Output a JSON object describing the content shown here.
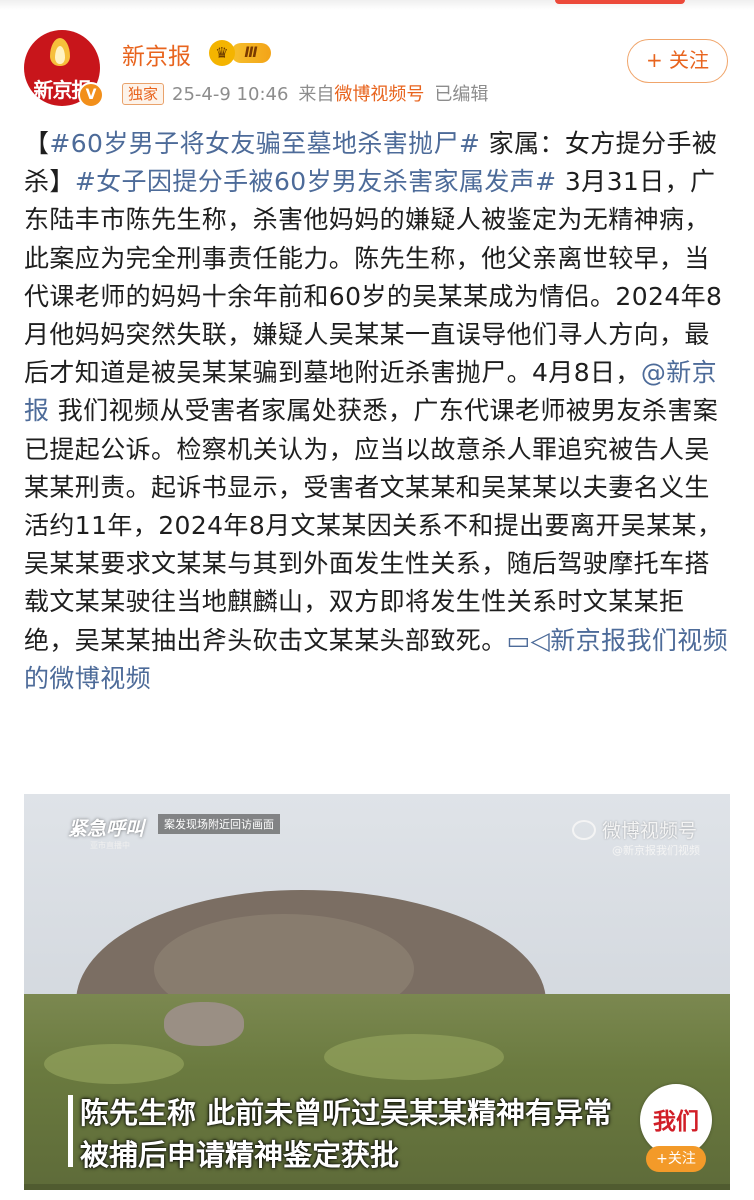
{
  "post": {
    "author": "新京报",
    "vip_level": "Ⅲ",
    "avatar_text": "新京报",
    "tag": "独家",
    "time": "25-4-9 10:46",
    "source_prefix": "来自",
    "source": "微博视频号",
    "edited": "已编辑",
    "follow_label": "+ 关注",
    "text": {
      "open_bracket": "【",
      "topic1": "#60岁男子将女友骗至墓地杀害抛尸#",
      "t1": " 家属：女方提分手被杀】",
      "topic2": "#女子因提分手被60岁男友杀害家属发声#",
      "t2": " 3月31日，广东陆丰市陈先生称，杀害他妈妈的嫌疑人被鉴定为无精神病，此案应为完全刑事责任能力。陈先生称，他父亲离世较早，当代课老师的妈妈十余年前和60岁的吴某某成为情侣。2024年8月他妈妈突然失联，嫌疑人吴某某一直误导他们寻人方向，最后才知道是被吴某某骗到墓地附近杀害抛尸。4月8日，",
      "mention": "@新京报",
      "t3": " 我们视频从受害者家属处获悉，广东代课老师被男友杀害案已提起公诉。检察机关认为，应当以故意杀人罪追究被告人吴某某刑责。起诉书显示，受害者文某某和吴某某以夫妻名义生活约11年，2024年8月文某某因关系不和提出要离开吴某某，吴某某要求文某某与其到外面发生性关系，随后驾驶摩托车搭载文某某驶往当地麒麟山，双方即将发生性关系时文某某拒绝，吴某某抽出斧头砍击文某某头部致死。",
      "video_link_icon": "▭◁",
      "video_link": "新京报我们视频的微博视频"
    }
  },
  "video": {
    "program_logo": "紧急呼叫",
    "program_sub": "亚市直播中",
    "scene_caption": "案发现场附近回访画面",
    "watermark": "微博视频号",
    "watermark_sub": "@新京报我们视频",
    "subtitle_line1": "陈先生称 此前未曾听过吴某某精神有异常",
    "subtitle_line2": "被捕后申请精神鉴定获批",
    "badge": "我们",
    "badge_follow": "+关注"
  },
  "colors": {
    "accent": "#e8641e",
    "link": "#4d6b99",
    "meta_gray": "#8d8d8d"
  }
}
